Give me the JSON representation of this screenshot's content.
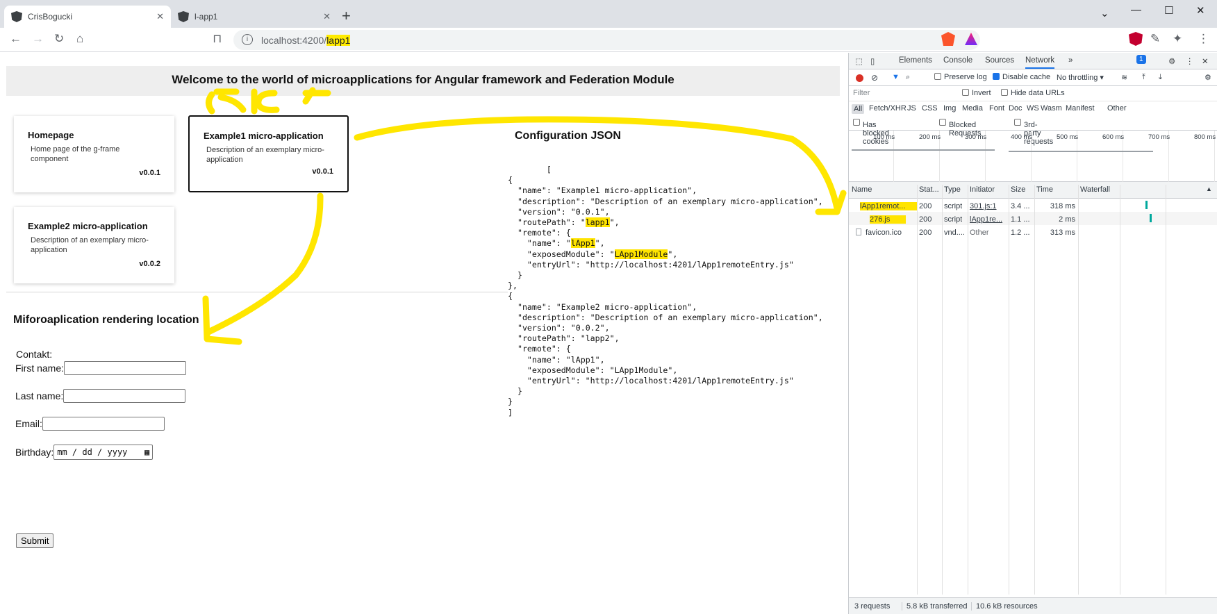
{
  "browser": {
    "tabs": [
      {
        "title": "CrisBogucki"
      },
      {
        "title": "l-app1"
      }
    ],
    "url_host": "localhost:4200/",
    "url_path": "lapp1"
  },
  "page": {
    "banner": "Welcome to the world of microapplications for Angular framework and Federation Module",
    "cards": [
      {
        "title": "Homepage",
        "description": "Home page of the g-frame component",
        "version": "v0.0.1"
      },
      {
        "title": "Example1 micro-application",
        "description": "Description of an exemplary micro-application",
        "version": "v0.0.1"
      },
      {
        "title": "Example2 micro-application",
        "description": "Description of an exemplary micro-application",
        "version": "v0.0.2"
      }
    ],
    "render_heading": "Miforoaplication rendering location",
    "form": {
      "title": "Contakt:",
      "first_name_label": "First name:",
      "last_name_label": "Last name:",
      "email_label": "Email:",
      "birthday_label": "Birthday:",
      "birthday_placeholder": "mm / dd / yyyy",
      "submit_label": "Submit"
    },
    "config_heading": "Configuration JSON"
  },
  "config": [
    {
      "name": "Example1 micro-application",
      "description": "Description of an exemplary micro-application",
      "version": "0.0.1",
      "routePath": "lapp1",
      "remote": {
        "name": "lApp1",
        "exposedModule": "LApp1Module",
        "entryUrl": "http://localhost:4201/lApp1remoteEntry.js"
      }
    },
    {
      "name": "Example2 micro-application",
      "description": "Description of an exemplary micro-application",
      "version": "0.0.2",
      "routePath": "lapp2",
      "remote": {
        "name": "lApp1",
        "exposedModule": "LApp1Module",
        "entryUrl": "http://localhost:4201/lApp1remoteEntry.js"
      }
    }
  ],
  "devtools": {
    "tabs": [
      "Elements",
      "Console",
      "Sources",
      "Network"
    ],
    "active_tab": "Network",
    "issues_badge": "1",
    "preserve_log": "Preserve log",
    "disable_cache": "Disable cache",
    "throttling": "No throttling",
    "filter_placeholder": "Filter",
    "invert": "Invert",
    "hide_data_urls": "Hide data URLs",
    "types": [
      "All",
      "Fetch/XHR",
      "JS",
      "CSS",
      "Img",
      "Media",
      "Font",
      "Doc",
      "WS",
      "Wasm",
      "Manifest",
      "Other"
    ],
    "has_blocked_cookies": "Has blocked cookies",
    "blocked_requests": "Blocked Requests",
    "third_party": "3rd-party requests",
    "timeline_ticks": [
      "100 ms",
      "200 ms",
      "300 ms",
      "400 ms",
      "500 ms",
      "600 ms",
      "700 ms",
      "800 ms"
    ],
    "columns": [
      "Name",
      "Stat...",
      "Type",
      "Initiator",
      "Size",
      "Time",
      "Waterfall"
    ],
    "requests": [
      {
        "name": "lApp1remot...",
        "status": "200",
        "type": "script",
        "initiator": "301.js:1",
        "size": "3.4 ...",
        "time": "318 ms"
      },
      {
        "name": "276.js",
        "status": "200",
        "type": "script",
        "initiator": "lApp1re...",
        "size": "1.1 ...",
        "time": "2 ms"
      },
      {
        "name": "favicon.ico",
        "status": "200",
        "type": "vnd....",
        "initiator": "Other",
        "size": "1.2 ...",
        "time": "313 ms"
      }
    ],
    "summary": {
      "requests": "3 requests",
      "transferred": "5.8 kB transferred",
      "resources": "10.6 kB resources"
    }
  },
  "colors": {
    "highlight": "#ffe400",
    "annotation": "#ffe600",
    "record": "#d93025"
  }
}
